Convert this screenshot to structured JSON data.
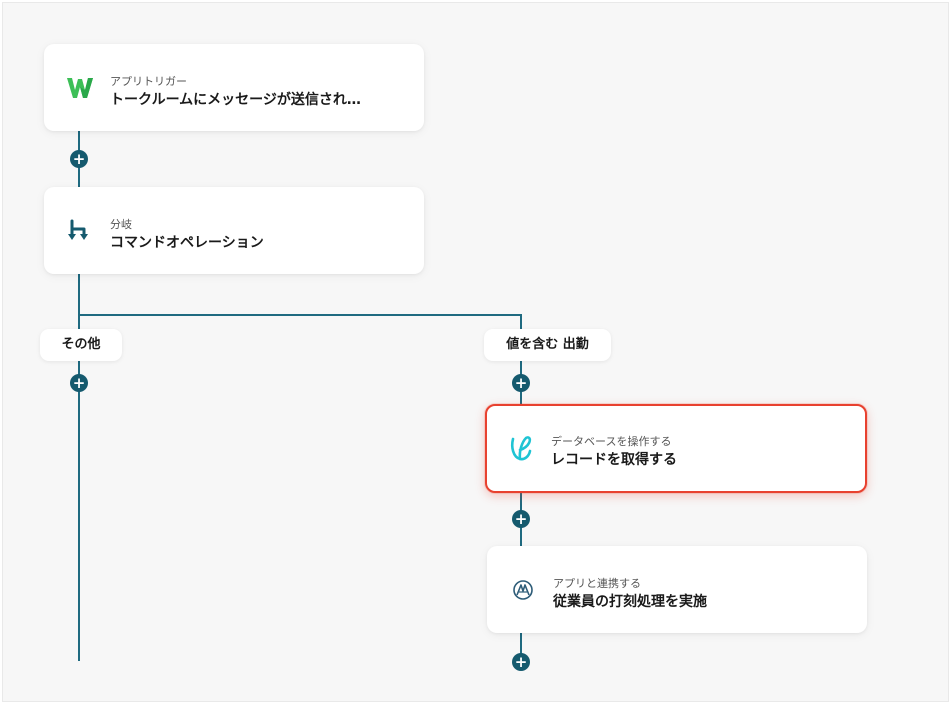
{
  "flow": {
    "trigger": {
      "subtitle": "アプリトリガー",
      "title": "トークルームにメッセージが送信され…",
      "icon": "worksmobile-w-icon"
    },
    "branch": {
      "subtitle": "分岐",
      "title": "コマンドオペレーション",
      "icon": "branch-icon"
    },
    "branch_labels": {
      "left": "その他",
      "right": "値を含む 出勤"
    },
    "db_step": {
      "subtitle": "データベースを操作する",
      "title": "レコードを取得する",
      "icon": "yoom-database-icon"
    },
    "app_step": {
      "subtitle": "アプリと連携する",
      "title": "従業員の打刻処理を実施",
      "icon": "attendance-app-icon"
    },
    "add_symbol": "+"
  },
  "colors": {
    "connector": "#1f6a80",
    "add_button": "#155a6e",
    "selected_border": "#e8412f",
    "canvas_bg": "#f7f7f7"
  }
}
